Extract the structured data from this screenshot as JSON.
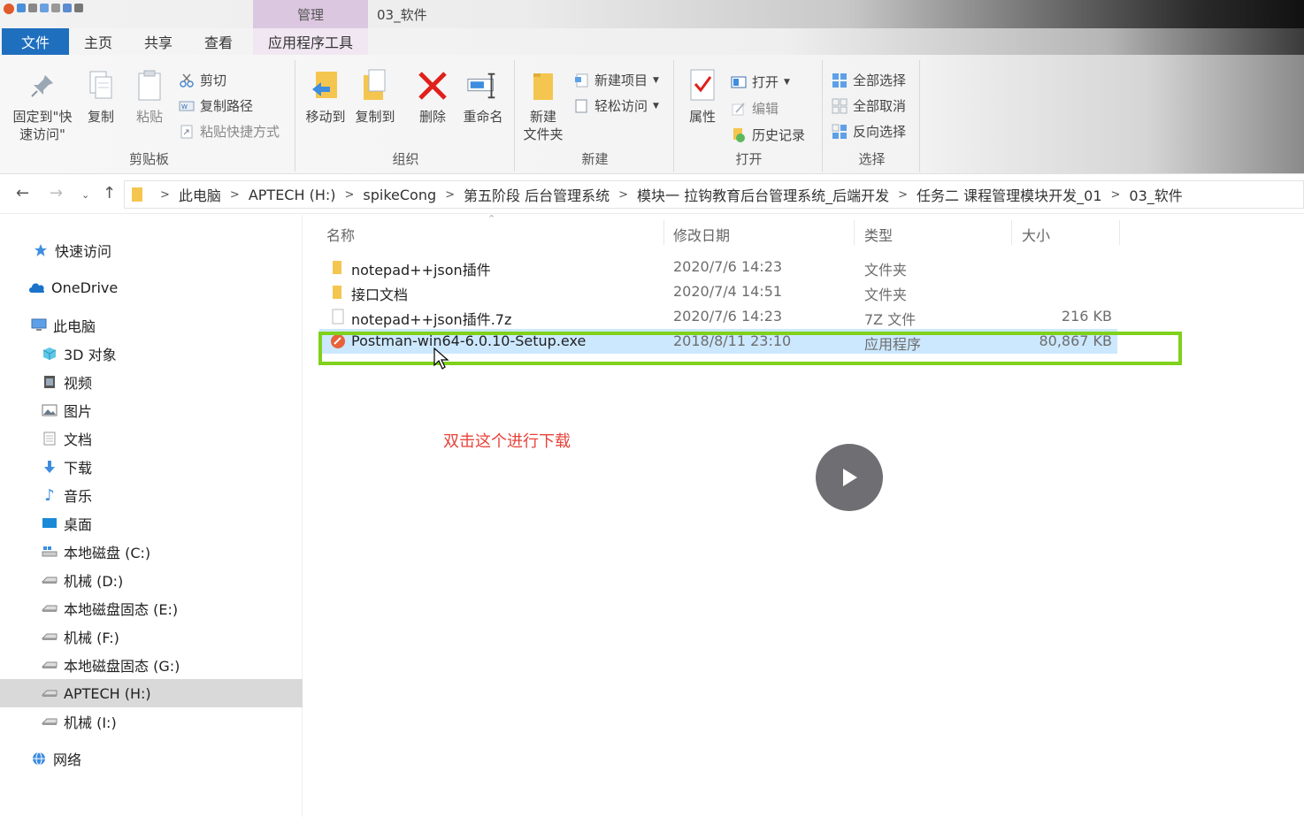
{
  "window": {
    "context_tab": "管理",
    "title": "03_软件"
  },
  "tabs": [
    "文件",
    "主页",
    "共享",
    "查看",
    "应用程序工具"
  ],
  "ribbon": {
    "clipboard": {
      "label": "剪贴板",
      "pin": "固定到\"快速访问\"",
      "pin_line1": "固定到\"快",
      "pin_line2": "速访问\"",
      "copy": "复制",
      "paste": "粘贴",
      "cut": "剪切",
      "copy_path": "复制路径",
      "paste_shortcut": "粘贴快捷方式"
    },
    "organize": {
      "label": "组织",
      "move_to": "移动到",
      "copy_to": "复制到",
      "delete": "删除",
      "rename": "重命名"
    },
    "new": {
      "label": "新建",
      "new_item": "新建项目",
      "easy_access": "轻松访问",
      "new_folder_line1": "新建",
      "new_folder_line2": "文件夹"
    },
    "open": {
      "label": "打开",
      "properties": "属性",
      "open": "打开",
      "edit": "编辑",
      "history": "历史记录"
    },
    "select": {
      "label": "选择",
      "select_all": "全部选择",
      "select_none": "全部取消",
      "invert": "反向选择"
    }
  },
  "breadcrumbs": [
    "此电脑",
    "APTECH (H:)",
    "spikeCong",
    "第五阶段 后台管理系统",
    "模块一 拉钩教育后台管理系统_后端开发",
    "任务二 课程管理模块开发_01",
    "03_软件"
  ],
  "nav": [
    {
      "label": "快速访问",
      "icon": "star-icon"
    },
    {
      "label": "OneDrive",
      "icon": "cloud-icon"
    },
    {
      "label": "此电脑",
      "icon": "computer-icon"
    },
    {
      "label": "3D 对象",
      "icon": "cube-icon"
    },
    {
      "label": "视频",
      "icon": "video-icon"
    },
    {
      "label": "图片",
      "icon": "picture-icon"
    },
    {
      "label": "文档",
      "icon": "document-icon"
    },
    {
      "label": "下载",
      "icon": "download-icon"
    },
    {
      "label": "音乐",
      "icon": "music-icon"
    },
    {
      "label": "桌面",
      "icon": "desktop-icon"
    },
    {
      "label": "本地磁盘 (C:)",
      "icon": "drive-icon"
    },
    {
      "label": "机械 (D:)",
      "icon": "drive-icon"
    },
    {
      "label": "本地磁盘固态 (E:)",
      "icon": "drive-icon"
    },
    {
      "label": "机械 (F:)",
      "icon": "drive-icon"
    },
    {
      "label": "本地磁盘固态 (G:)",
      "icon": "drive-icon"
    },
    {
      "label": "APTECH (H:)",
      "icon": "drive-icon"
    },
    {
      "label": "机械 (I:)",
      "icon": "drive-icon"
    },
    {
      "label": "网络",
      "icon": "network-icon"
    }
  ],
  "columns": {
    "name": "名称",
    "date": "修改日期",
    "type": "类型",
    "size": "大小"
  },
  "files": [
    {
      "name": "notepad++json插件",
      "date": "2020/7/6 14:23",
      "type": "文件夹",
      "size": "",
      "icon": "folder-icon"
    },
    {
      "name": "接口文档",
      "date": "2020/7/4 14:51",
      "type": "文件夹",
      "size": "",
      "icon": "folder-icon"
    },
    {
      "name": "notepad++json插件.7z",
      "date": "2020/7/6 14:23",
      "type": "7Z 文件",
      "size": "216 KB",
      "icon": "archive-file-icon"
    },
    {
      "name": "Postman-win64-6.0.10-Setup.exe",
      "date": "2018/8/11 23:10",
      "type": "应用程序",
      "size": "80,867 KB",
      "icon": "postman-app-icon"
    }
  ],
  "annotation": "双击这个进行下载",
  "colors": {
    "accent": "#1f6fbf",
    "selection": "#cce8ff",
    "highlight": "#7fd11b",
    "annotation": "#e8423a"
  }
}
